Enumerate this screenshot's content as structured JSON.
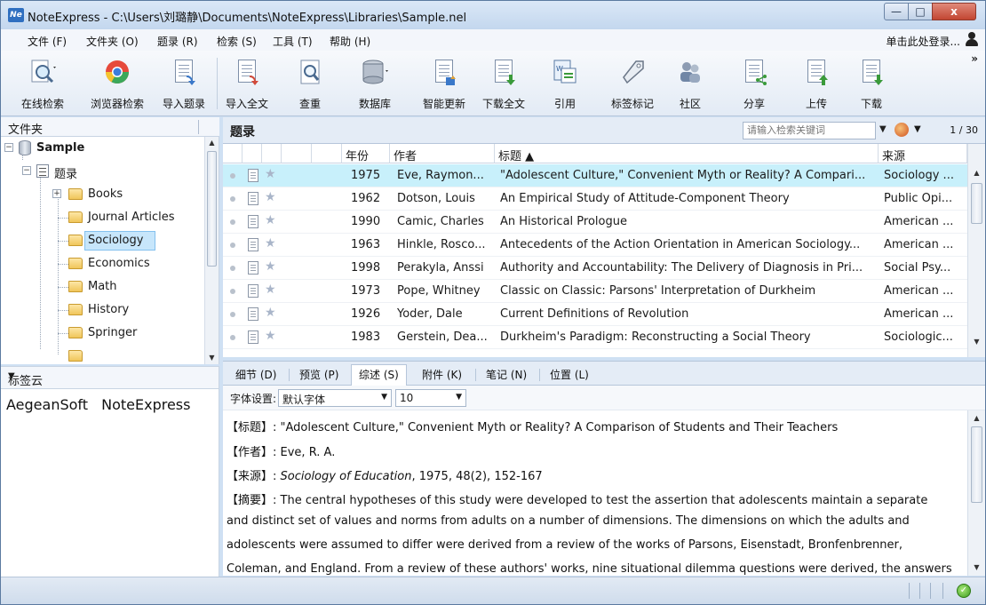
{
  "window": {
    "title": "NoteExpress - C:\\Users\\刘璐静\\Documents\\NoteExpress\\Libraries\\Sample.nel",
    "logo_text": "Ne",
    "minimize_symbol": "—",
    "maximize_symbol": "□",
    "close_symbol": "x"
  },
  "menu": {
    "items": [
      "文件 (F)",
      "文件夹 (O)",
      "题录 (R)",
      "检索 (S)",
      "工具 (T)",
      "帮助 (H)"
    ],
    "login": "单击此处登录..."
  },
  "toolbar": {
    "buttons": [
      "在线检索",
      "浏览器检索",
      "导入题录",
      "导入全文",
      "查重",
      "数据库",
      "智能更新",
      "下载全文",
      "引用",
      "标签标记",
      "社区",
      "分享",
      "上传",
      "下载"
    ],
    "more": "»"
  },
  "folders": {
    "header": "文件夹",
    "root": "Sample",
    "records_node": "题录",
    "items": [
      "Books",
      "Journal Articles",
      "Sociology",
      "Economics",
      "Math",
      "History",
      "Springer"
    ],
    "selected": "Sociology",
    "expand_minus": "−",
    "expand_plus": "+"
  },
  "tags": {
    "header": "标签云",
    "items": [
      "AegeanSoft",
      "NoteExpress"
    ],
    "dropdown": "▼"
  },
  "records": {
    "header": "题录",
    "search_placeholder": "请输入检索关键词",
    "page_count": "1 / 30",
    "columns": {
      "year": "年份",
      "author": "作者",
      "title": "标题 ▲",
      "source": "来源"
    },
    "rows": [
      {
        "year": "1975",
        "author": "Eve, Raymon...",
        "title": "\"Adolescent Culture,\" Convenient Myth or Reality? A Compari...",
        "source": "Sociology ..."
      },
      {
        "year": "1962",
        "author": "Dotson, Louis",
        "title": "An Empirical Study of Attitude-Component Theory",
        "source": "Public Opi..."
      },
      {
        "year": "1990",
        "author": "Camic, Charles",
        "title": "An Historical Prologue",
        "source": "American ..."
      },
      {
        "year": "1963",
        "author": "Hinkle, Rosco...",
        "title": "Antecedents of the Action Orientation in American Sociology...",
        "source": "American ..."
      },
      {
        "year": "1998",
        "author": "Perakyla, Anssi",
        "title": "Authority and Accountability: The Delivery of Diagnosis in Pri...",
        "source": "Social Psy..."
      },
      {
        "year": "1973",
        "author": "Pope, Whitney",
        "title": "Classic on Classic: Parsons' Interpretation of Durkheim",
        "source": "American ..."
      },
      {
        "year": "1926",
        "author": "Yoder, Dale",
        "title": "Current Definitions of Revolution",
        "source": "American ..."
      },
      {
        "year": "1983",
        "author": "Gerstein, Dea...",
        "title": "Durkheim's Paradigm: Reconstructing a Social Theory",
        "source": "Sociologic..."
      }
    ],
    "selected_index": 0
  },
  "detail_tabs": {
    "items": [
      "细节 (D)",
      "预览 (P)",
      "综述 (S)",
      "附件 (K)",
      "笔记 (N)",
      "位置 (L)"
    ],
    "active": "综述 (S)"
  },
  "font_settings": {
    "label": "字体设置:",
    "font": "默认字体",
    "size": "10"
  },
  "detail": {
    "title_label": "【标题】",
    "title": ": \"Adolescent Culture,\" Convenient Myth or Reality? A Comparison of Students and Their Teachers",
    "author_label": "【作者】",
    "author": ": Eve, R. A.",
    "source_label": "【来源】",
    "source_sep": ": ",
    "source_journal": "Sociology of Education",
    "source_rest": ", 1975, 48(2), 152-167",
    "abstract_label": "【摘要】",
    "abstract_lines": [
      ": The central hypotheses of this study were developed to test the assertion that adolescents maintain a separate",
      "and distinct set of values and norms from adults on a number of dimensions. The dimensions on which the adults and",
      "adolescents were assumed to differ were derived from a review of the works of Parsons, Eisenstadt, Bronfenbrenner,",
      "Coleman, and England. From a review of these authors' works, nine situational dilemma questions were derived, the answers"
    ]
  }
}
